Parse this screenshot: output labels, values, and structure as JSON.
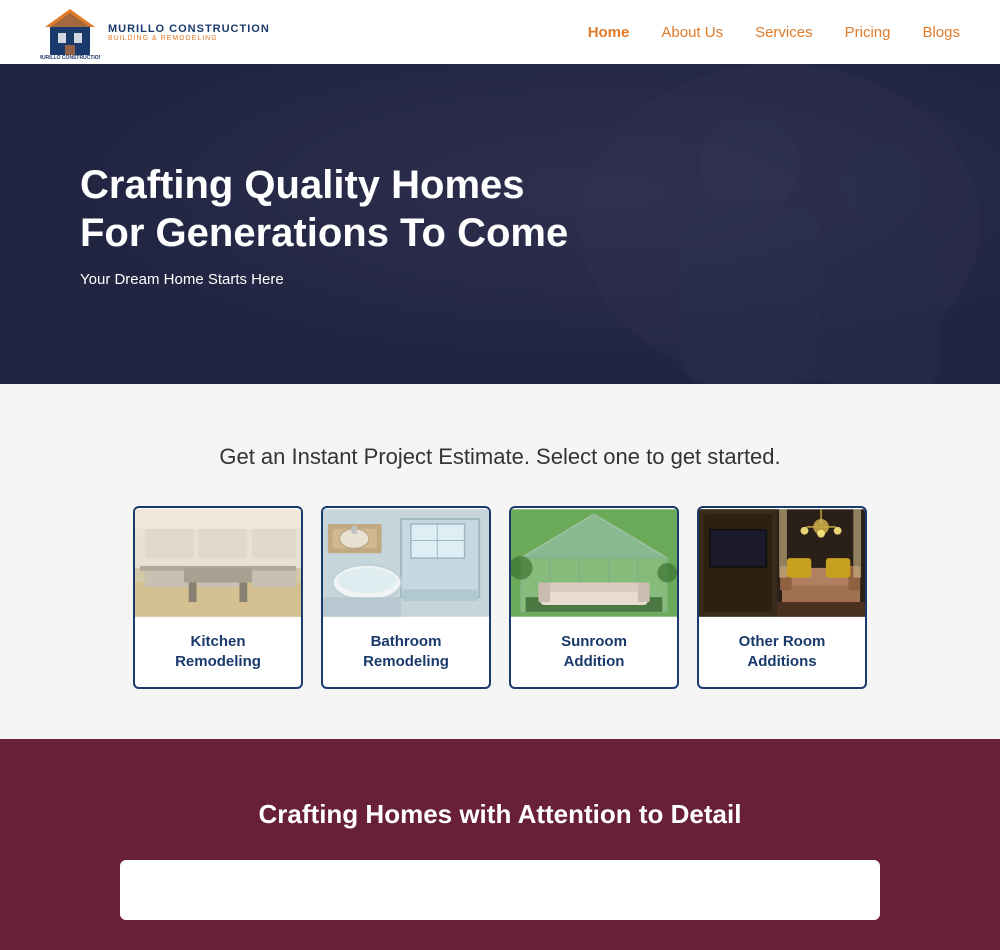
{
  "header": {
    "logo_company": "MURILLO CONSTRUCTION",
    "logo_tagline": "BUILDING & REMODELING",
    "nav": [
      {
        "label": "Home",
        "id": "home",
        "active": true
      },
      {
        "label": "About Us",
        "id": "about"
      },
      {
        "label": "Services",
        "id": "services"
      },
      {
        "label": "Pricing",
        "id": "pricing"
      },
      {
        "label": "Blogs",
        "id": "blogs"
      }
    ]
  },
  "hero": {
    "title_line1": "Crafting Quality Homes",
    "title_line2": "For Generations To Come",
    "subtitle": "Your Dream Home Starts Here"
  },
  "estimate": {
    "title": "Get an Instant Project Estimate. Select one to get started.",
    "cards": [
      {
        "id": "kitchen",
        "label": "Kitchen\nRemodeling",
        "label_line1": "Kitchen",
        "label_line2": "Remodeling"
      },
      {
        "id": "bathroom",
        "label": "Bathroom\nRemodeling",
        "label_line1": "Bathroom",
        "label_line2": "Remodeling"
      },
      {
        "id": "sunroom",
        "label": "Sunroom\nAddition",
        "label_line1": "Sunroom",
        "label_line2": "Addition"
      },
      {
        "id": "other",
        "label": "Other Room\nAdditions",
        "label_line1": "Other Room",
        "label_line2": "Additions"
      }
    ]
  },
  "crafting": {
    "title": "Crafting Homes with Attention to Detail"
  },
  "colors": {
    "nav_accent": "#e07b2a",
    "nav_link": "#e07b2a",
    "card_border": "#1a3a6b",
    "hero_bg": "#2a2d47",
    "crafting_bg": "#7a2a45"
  }
}
